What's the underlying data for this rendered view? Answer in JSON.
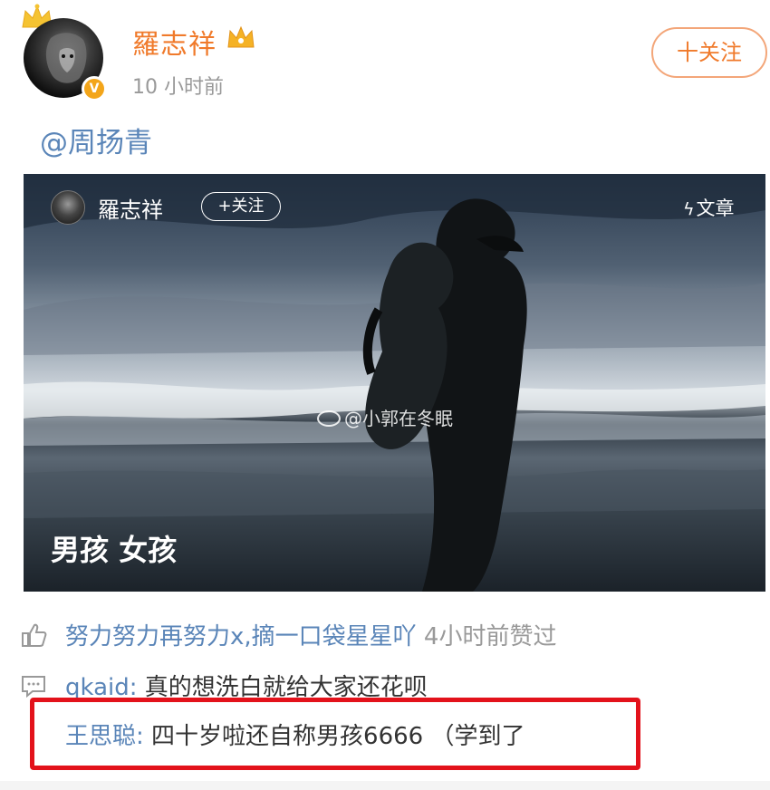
{
  "post": {
    "author": {
      "name": "羅志祥",
      "avatar_icon": "lion-avatar-icon",
      "verified_icon": "verified-v-icon",
      "verified_glyph": "V",
      "vip_icon": "crown-icon"
    },
    "time": "10 小时前",
    "follow_label": "十关注",
    "mention": "@周扬青"
  },
  "card": {
    "author_name": "羅志祥",
    "follow_label": "+关注",
    "article_label": "文章",
    "article_icon": "lightning-icon",
    "watermark": "@小郭在冬眠",
    "watermark_icon": "weibo-logo-icon",
    "caption": "男孩 女孩"
  },
  "interactions": {
    "like": {
      "icon": "thumbs-up-icon",
      "user": "努力努力再努力x,摘一口袋星星吖",
      "suffix": "4小时前赞过"
    },
    "comment": {
      "icon": "comment-icon",
      "user": "qkaid:",
      "text": "真的想洗白就给大家还花呗"
    },
    "reply": {
      "user": "王思聪:",
      "text": "四十岁啦还自称男孩6666 （学到了"
    }
  },
  "colors": {
    "accent_orange": "#f07a2b",
    "link_blue": "#5a85b8",
    "highlight_red": "#e3121b",
    "verified_gold": "#f3a51a"
  }
}
